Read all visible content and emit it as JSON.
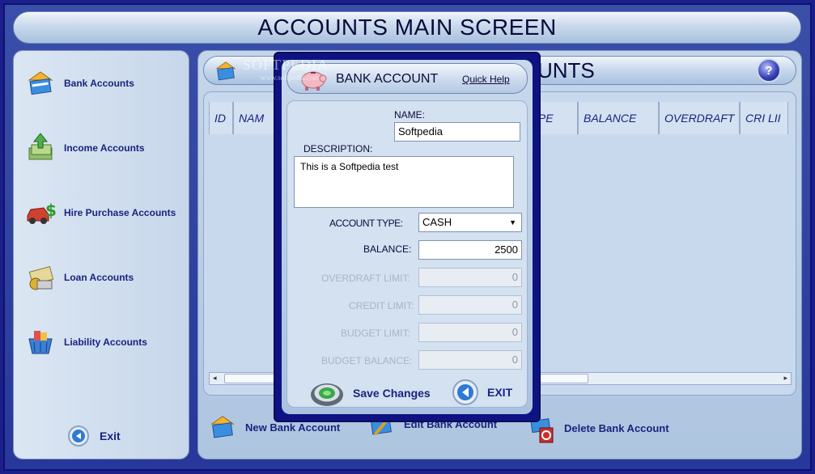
{
  "main_title": "ACCOUNTS MAIN SCREEN",
  "sidebar": {
    "items": [
      {
        "label": "Bank Accounts",
        "icon": "bank-card-icon"
      },
      {
        "label": "Income Accounts",
        "icon": "income-money-icon"
      },
      {
        "label": "Hire Purchase Accounts",
        "icon": "car-dollar-icon"
      },
      {
        "label": "Loan Accounts",
        "icon": "loan-money-icon"
      },
      {
        "label": "Liability Accounts",
        "icon": "shopping-basket-icon"
      }
    ],
    "exit_label": "Exit"
  },
  "content": {
    "header_title_visible": "UNTS",
    "columns": [
      "ID",
      "NAM",
      "TYPE",
      "BALANCE",
      "OVERDRAFT",
      "CRI LII"
    ],
    "actions": {
      "new": "New Bank Account",
      "edit": "Edit Bank Account",
      "delete": "Delete Bank Account"
    }
  },
  "watermark": {
    "main": "SOFTPEDIA",
    "sub": "www.softpedia.com"
  },
  "dialog": {
    "title": "BANK ACCOUNT",
    "quick_help": "Quick Help",
    "name_label": "NAME:",
    "name_value": "Softpedia",
    "description_label": "DESCRIPTION:",
    "description_value": "This is a Softpedia test",
    "account_type_label": "ACCOUNT TYPE:",
    "account_type_value": "CASH",
    "balance_label": "BALANCE:",
    "balance_value": "2500",
    "overdraft_limit_label": "OVERDRAFT LIMIT:",
    "overdraft_limit_value": "0",
    "credit_limit_label": "CREDIT LIMIT:",
    "credit_limit_value": "0",
    "budget_limit_label": "BUDGET LIMIT:",
    "budget_limit_value": "0",
    "budget_balance_label": "BUDGET BALANCE:",
    "budget_balance_value": "0",
    "save_label": "Save Changes",
    "exit_label": "EXIT"
  },
  "colors": {
    "frame": "#1a1f8c",
    "accent": "#1a237e",
    "dialog_border": "#0e1383"
  }
}
